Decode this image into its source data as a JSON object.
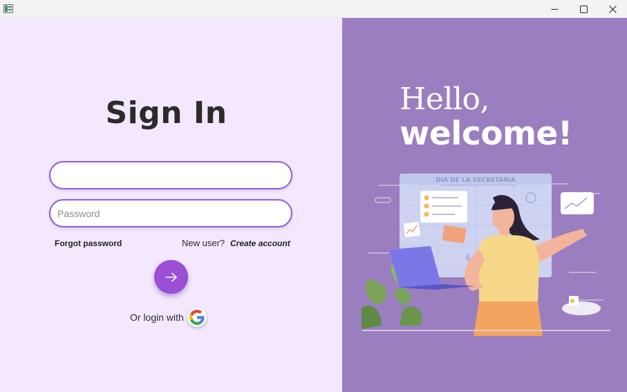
{
  "window": {
    "app_icon": "app-window-icon",
    "controls": [
      "minimize-icon",
      "maximize-icon",
      "close-icon"
    ]
  },
  "signin": {
    "title": "Sign In",
    "username": {
      "value": "",
      "placeholder": ""
    },
    "password": {
      "value": "",
      "placeholder": "Password"
    },
    "forgot_password": "Forgot password",
    "new_user": "New user?",
    "create_account": "Create account",
    "submit_icon": "arrow-right-icon",
    "or_login_with": "Or login with",
    "google_icon": "google-icon"
  },
  "welcome_panel": {
    "hello": "Hello,",
    "welcome": "welcome!",
    "board_caption": "DIA DE LA SECRETARIA"
  },
  "colors": {
    "left_background": "#f3e8fd",
    "right_background": "#9b7ebf",
    "accent": "#9a4fd4",
    "field_border": "#8c5fd6"
  }
}
